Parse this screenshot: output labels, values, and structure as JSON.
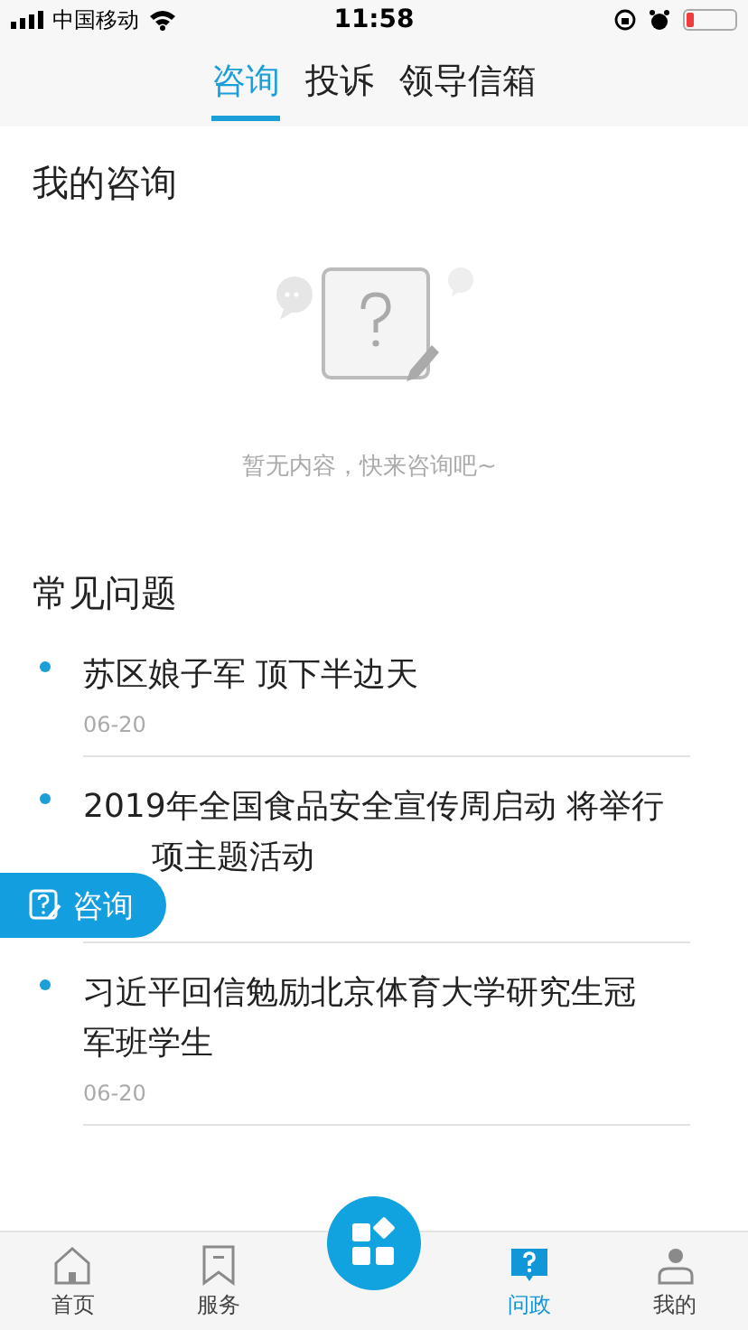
{
  "status_bar": {
    "carrier": "中国移动",
    "time": "11:58"
  },
  "tabs": [
    {
      "label": "咨询",
      "selected": true
    },
    {
      "label": "投诉",
      "selected": false
    },
    {
      "label": "领导信箱",
      "selected": false
    }
  ],
  "my_consult": {
    "title": "我的咨询",
    "empty_text": "暂无内容，快来咨询吧~"
  },
  "faq": {
    "title": "常见问题",
    "items": [
      {
        "lines": [
          "苏区娘子军 顶下半边天"
        ],
        "date": "06-20"
      },
      {
        "lines": [
          "2019年全国食品安全宣传周启动 将举行",
          "项主题活动"
        ]
      },
      {
        "lines": [
          "习近平回信勉励北京体育大学研究生冠",
          "军班学生"
        ],
        "date": "06-20"
      }
    ]
  },
  "float_button": {
    "label": "咨询"
  },
  "nav": [
    {
      "kind": "home",
      "label": "首页",
      "selected": false
    },
    {
      "kind": "bookmark",
      "label": "服务",
      "selected": false
    },
    {
      "kind": "center"
    },
    {
      "kind": "question",
      "label": "问政",
      "selected": true
    },
    {
      "kind": "person",
      "label": "我的",
      "selected": false
    }
  ]
}
